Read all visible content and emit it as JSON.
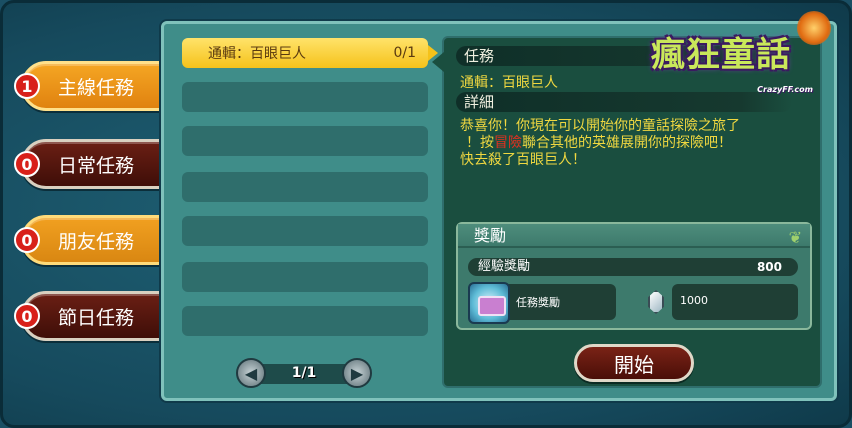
{
  "tabs": [
    {
      "badge": "1",
      "label": "主線任務",
      "style": "active"
    },
    {
      "badge": "0",
      "label": "日常任務",
      "style": "dark"
    },
    {
      "badge": "0",
      "label": "朋友任務",
      "style": "gold"
    },
    {
      "badge": "0",
      "label": "節日任務",
      "style": "dark"
    }
  ],
  "quest_list": {
    "selected": {
      "name": "通輯：百眼巨人",
      "progress": "0/1"
    },
    "empty_rows": 6
  },
  "pager": {
    "prev_icon": "arrow-left-icon",
    "next_icon": "arrow-right-icon",
    "label": "1/1"
  },
  "detail": {
    "task_header": "任務",
    "quest_name": "通輯：百眼巨人",
    "detail_header": "詳細",
    "desc_line1": "恭喜你！你現在可以開始你的童話探險之旅了",
    "desc_line2_pre": "！按",
    "desc_line2_hl": "冒險",
    "desc_line2_post": "聯合其他的英雄展開你的探險吧！",
    "desc_line3": "快去殺了百眼巨人！"
  },
  "reward": {
    "title": "獎勵",
    "exp_label": "經驗獎勵",
    "exp_value": "800",
    "item_label": "任務獎勵",
    "currency_value": "1000"
  },
  "start_button": "開始",
  "logo": {
    "title": "瘋狂童話",
    "subtitle": "CrazyFF.com"
  },
  "colors": {
    "accent_gold": "#f5c21a",
    "text_yellow": "#f0d840",
    "highlight_red": "#e03020",
    "tab_dark": "#4a0e08"
  }
}
